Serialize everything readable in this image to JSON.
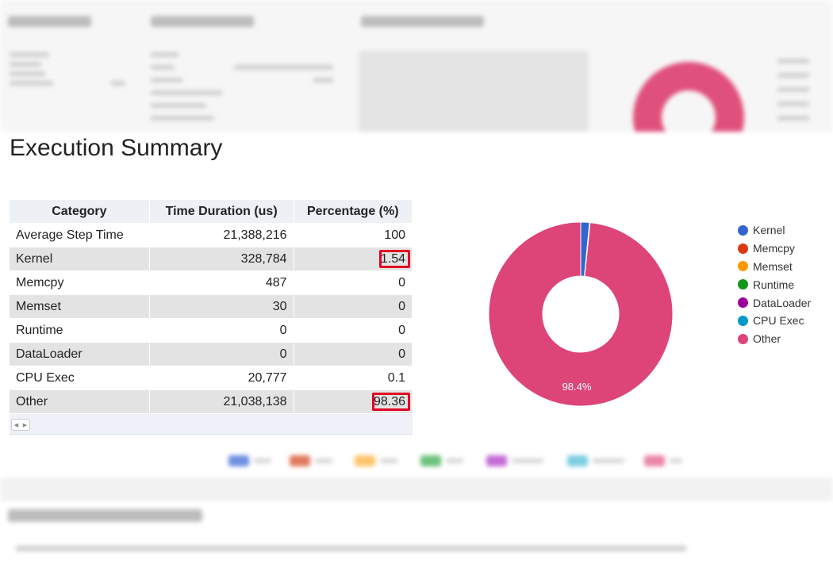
{
  "section": {
    "title": "Execution Summary"
  },
  "table": {
    "headers": [
      "Category",
      "Time Duration (us)",
      "Percentage (%)"
    ],
    "rows": [
      {
        "category": "Average Step Time",
        "duration": "21,388,216",
        "percentage": "100",
        "highlighted": false
      },
      {
        "category": "Kernel",
        "duration": "328,784",
        "percentage": "1.54",
        "highlighted": true
      },
      {
        "category": "Memcpy",
        "duration": "487",
        "percentage": "0",
        "highlighted": false
      },
      {
        "category": "Memset",
        "duration": "30",
        "percentage": "0",
        "highlighted": false
      },
      {
        "category": "Runtime",
        "duration": "0",
        "percentage": "0",
        "highlighted": false
      },
      {
        "category": "DataLoader",
        "duration": "0",
        "percentage": "0",
        "highlighted": false
      },
      {
        "category": "CPU Exec",
        "duration": "20,777",
        "percentage": "0.1",
        "highlighted": false
      },
      {
        "category": "Other",
        "duration": "21,038,138",
        "percentage": "98.36",
        "highlighted": true
      }
    ],
    "highlight_color": "#e00023"
  },
  "chart_data": {
    "type": "pie",
    "donut": true,
    "categories": [
      "Kernel",
      "Memcpy",
      "Memset",
      "Runtime",
      "DataLoader",
      "CPU Exec",
      "Other"
    ],
    "values": [
      1.54,
      0,
      0,
      0,
      0,
      0.1,
      98.36
    ],
    "colors": [
      "#3366cc",
      "#dc3912",
      "#ff9900",
      "#109618",
      "#990099",
      "#0099c6",
      "#dd4477"
    ],
    "slice_labels": [
      "",
      "",
      "",
      "",
      "",
      "",
      "98.4%"
    ],
    "legend_position": "right"
  }
}
